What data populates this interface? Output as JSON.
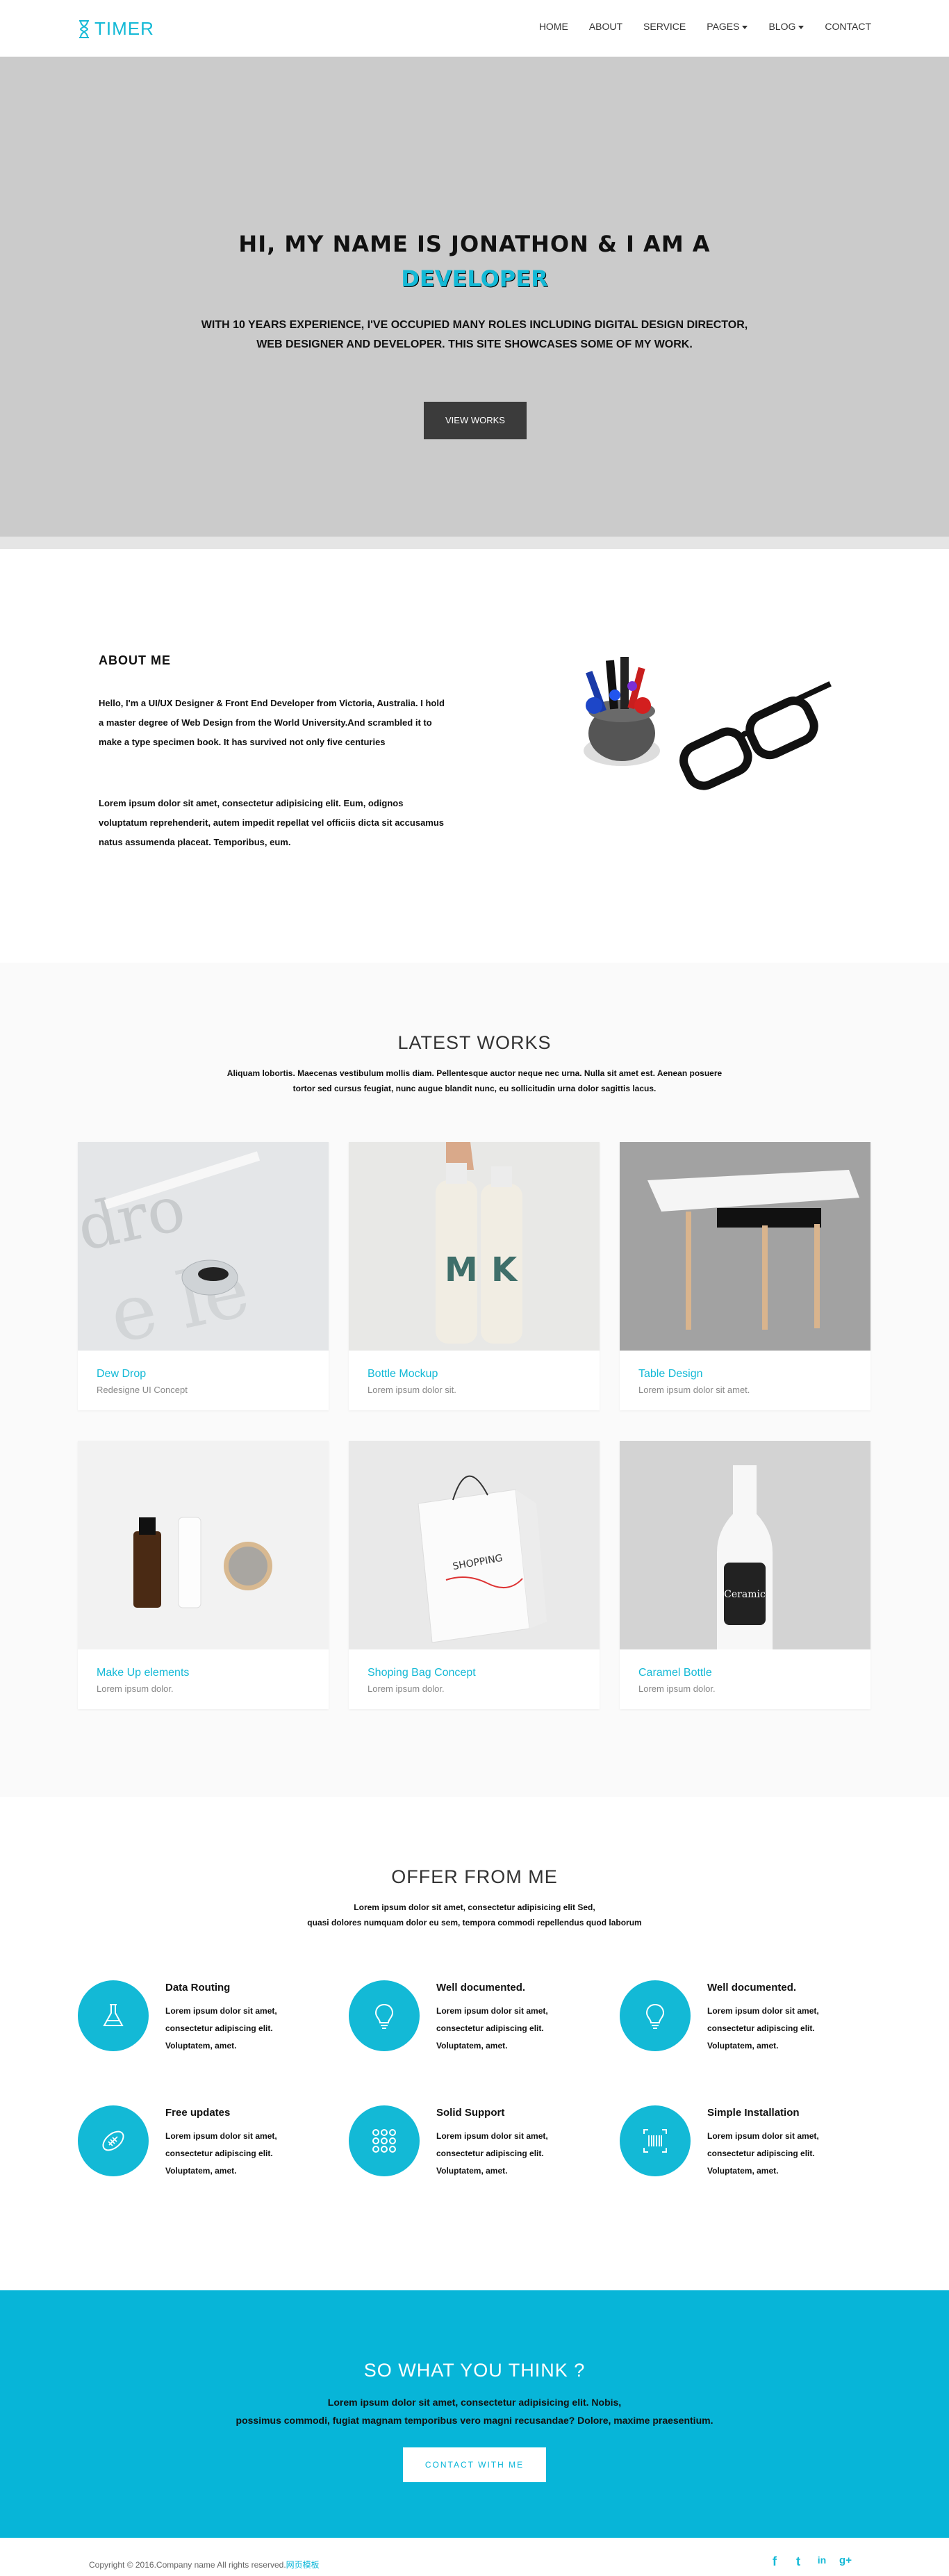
{
  "nav": {
    "logo": "TIMER",
    "items": [
      {
        "label": "HOME",
        "dropdown": false
      },
      {
        "label": "ABOUT",
        "dropdown": false
      },
      {
        "label": "SERVICE",
        "dropdown": false
      },
      {
        "label": "PAGES",
        "dropdown": true
      },
      {
        "label": "BLOG",
        "dropdown": true
      },
      {
        "label": "CONTACT",
        "dropdown": false
      }
    ]
  },
  "hero": {
    "line1": "HI, MY NAME IS JONATHON & I AM A",
    "line2": "DEVELOPER",
    "desc1": "WITH 10 YEARS EXPERIENCE, I'VE OCCUPIED MANY ROLES INCLUDING DIGITAL DESIGN DIRECTOR,",
    "desc2": "WEB DESIGNER AND DEVELOPER. THIS SITE SHOWCASES SOME OF MY WORK.",
    "button": "VIEW WORKS"
  },
  "about": {
    "title": "ABOUT ME",
    "p1": "Hello, I'm a UI/UX Designer & Front End Developer from Victoria, Australia. I hold a master degree of Web Design from the World University.And scrambled it to make a type specimen book. It has survived not only five centuries",
    "p2": "Lorem ipsum dolor sit amet, consectetur adipisicing elit. Eum, odignos voluptatum reprehenderit, autem impedit repellat vel officiis dicta sit accusamus natus assumenda placeat. Temporibus, eum."
  },
  "works": {
    "title": "LATEST WORKS",
    "sub1": "Aliquam lobortis. Maecenas vestibulum mollis diam. Pellentesque auctor neque nec urna. Nulla sit amet est. Aenean posuere",
    "sub2": "tortor sed cursus feugiat, nunc augue blandit nunc, eu sollicitudin urna dolor sagittis lacus.",
    "items": [
      {
        "title": "Dew Drop",
        "desc": "Redesigne UI Concept"
      },
      {
        "title": "Bottle Mockup",
        "desc": "Lorem ipsum dolor sit."
      },
      {
        "title": "Table Design",
        "desc": "Lorem ipsum dolor sit amet."
      },
      {
        "title": "Make Up elements",
        "desc": "Lorem ipsum dolor."
      },
      {
        "title": "Shoping Bag Concept",
        "desc": "Lorem ipsum dolor."
      },
      {
        "title": "Caramel Bottle",
        "desc": "Lorem ipsum dolor."
      }
    ]
  },
  "offer": {
    "title": "OFFER FROM ME",
    "sub1": "Lorem ipsum dolor sit amet, consectetur adipisicing elit Sed,",
    "sub2": "quasi dolores numquam dolor eu sem, tempora commodi repellendus quod laborum",
    "services": [
      {
        "title": "Data Routing",
        "icon": "flask-icon",
        "l1": "Lorem ipsum dolor sit amet,",
        "l2": "consectetur adipiscing elit.",
        "l3": "Voluptatem, amet."
      },
      {
        "title": "Well documented.",
        "icon": "lightbulb-icon",
        "l1": "Lorem ipsum dolor sit amet,",
        "l2": "consectetur adipiscing elit.",
        "l3": "Voluptatem, amet."
      },
      {
        "title": "Well documented.",
        "icon": "lightbulb-icon",
        "l1": "Lorem ipsum dolor sit amet,",
        "l2": "consectetur adipiscing elit.",
        "l3": "Voluptatem, amet."
      },
      {
        "title": "Free updates",
        "icon": "football-icon",
        "l1": "Lorem ipsum dolor sit amet,",
        "l2": "consectetur adipiscing elit.",
        "l3": "Voluptatem, amet."
      },
      {
        "title": "Solid Support",
        "icon": "dots-grid-icon",
        "l1": "Lorem ipsum dolor sit amet,",
        "l2": "consectetur adipiscing elit.",
        "l3": "Voluptatem, amet."
      },
      {
        "title": "Simple Installation",
        "icon": "barcode-icon",
        "l1": "Lorem ipsum dolor sit amet,",
        "l2": "consectetur adipiscing elit.",
        "l3": "Voluptatem, amet."
      }
    ]
  },
  "cta": {
    "title": "SO WHAT YOU THINK ?",
    "line1": "Lorem ipsum dolor sit amet, consectetur adipisicing elit. Nobis,",
    "line2": "possimus commodi, fugiat magnam temporibus vero magni recusandae? Dolore, maxime praesentium.",
    "button": "CONTACT WITH ME"
  },
  "footer": {
    "copy": "Copyright © 2016.Company name All rights reserved.",
    "link": "网页模板",
    "social": [
      "f",
      "t",
      "in",
      "g+"
    ]
  },
  "colors": {
    "accent": "#13b9d6",
    "cta_bg": "#07b5d8",
    "hero_bg": "#cbcbcb"
  }
}
